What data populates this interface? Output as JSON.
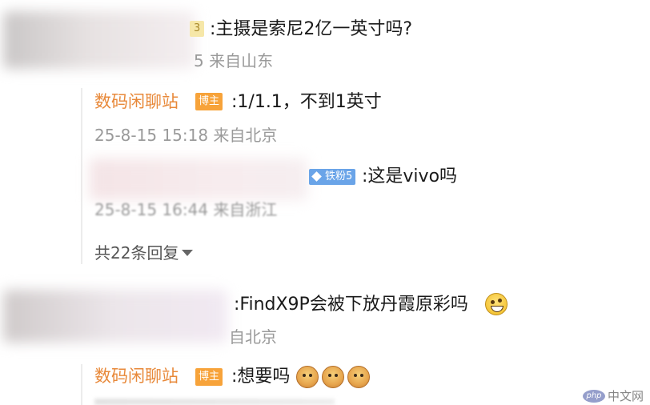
{
  "comment1": {
    "badge_suffix": "3",
    "text": ":主摄是索尼2亿一英寸吗?",
    "meta_visible": "5 来自山东"
  },
  "reply1": {
    "author": "数码闲聊站",
    "role_badge": "博主",
    "text": ":1/1.1，不到1英寸",
    "meta": "25-8-15 15:18 来自北京"
  },
  "reply2": {
    "fan_badge": "铁粉5",
    "text": ":这是vivo吗",
    "meta": "25-8-15 16:44 来自浙江"
  },
  "more_replies": {
    "label": "共22条回复",
    "icon": "caret-down-icon"
  },
  "comment2": {
    "text": ":FindX9P会被下放丹霞原彩吗",
    "meta_visible": "自北京",
    "emoji": "grin-emoji"
  },
  "reply3": {
    "author": "数码闲聊站",
    "role_badge": "博主",
    "text": ":想要吗",
    "emoji": "monkey-emoji"
  },
  "watermark": {
    "text": "中文网",
    "logo": "php"
  },
  "colors": {
    "author": "#e8893a",
    "meta": "#9a9a9a",
    "host_badge": "#f7a33a",
    "fan_badge": "#6aa4e8"
  }
}
